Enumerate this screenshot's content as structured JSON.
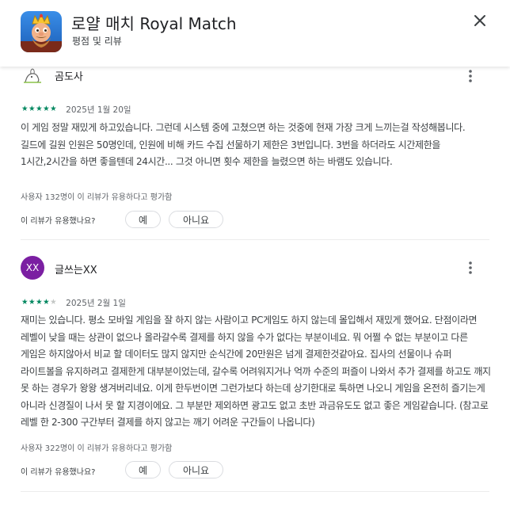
{
  "header": {
    "app_icon": "royal-match-app-icon",
    "title": "로얄 매치 Royal Match",
    "subtitle": "평점 및 리뷰",
    "close_icon": "close-icon"
  },
  "colors": {
    "star": "#01875f",
    "avatar2": "#7b1fa2",
    "divider": "#ececec"
  },
  "reviews": [
    {
      "author": "곰도사",
      "avatar_icon": "avatar-drawing",
      "rating": 5,
      "stars": "★★★★★",
      "date": "2025년 1월 20일",
      "text": "이 게임 정말 재밌게 하고있습니다. 그런데 시스템 중에 고쳤으면 하는 것중에 현재 가장 크게 느끼는걸 작성해봅니다. 길드에 길원 인원은 50명인데, 인원에 비해 카드 수집 선물하기 제한은 3번입니다. 3번을 하더라도 시간제한을 1시간,2시간을 하면 좋을텐데 24시간... 그것 아니면 횟수 제한을 늘렸으면 하는 바램도 있습니다.",
      "helpful_count": "사용자 132명이 이 리뷰가 유용하다고 평가함",
      "helpful_question": "이 리뷰가 유용했나요?",
      "yes_label": "예",
      "no_label": "아니요"
    },
    {
      "author": "글쓰는XX",
      "avatar_text": "XX",
      "rating": 4,
      "stars": "★★★★",
      "date": "2025년 2월 1일",
      "text": "재미는 있습니다. 평소 모바일 게임을 잘 하지 않는 사람이고 PC게임도 하지 않는데 몰입해서 재밌게 했어요. 단점이라면 레벨이 낮을 때는 상관이 없으나 올라갈수록 결제를 하지 않을 수가 없다는 부분이네요. 뭐 어쩔 수 없는 부분이고 다른 게임은 하지않아서 비교 할 데이터도 많지 않지만 순식간에 20만원은 넘게 결제한것같아요. 집사의 선물이나 슈퍼 라이트볼을 유지하려고 결제한게 대부분이었는데, 갈수록 어려워지거나 억까 수준의 퍼즐이 나와서 추가 결제를 하고도 깨지 못 하는 경우가 왕왕 생겨버리네요. 이게 한두번이면 그런가보다 하는데 상기한대로 툭하면 나오니 게임을 온전히 즐기는게 아니라 신경질이 나서 못 할 지경이에요. 그 부분만 제외하면 광고도 없고 초반 과금유도도 없고 좋은 게임같습니다. (참고로 레벨 한 2-300 구간부터 결제를 하지 않고는 깨기 어려운 구간들이 나옵니다)",
      "helpful_count": "사용자 322명이 이 리뷰가 유용하다고 평가함",
      "helpful_question": "이 리뷰가 유용했나요?",
      "yes_label": "예",
      "no_label": "아니요"
    }
  ]
}
